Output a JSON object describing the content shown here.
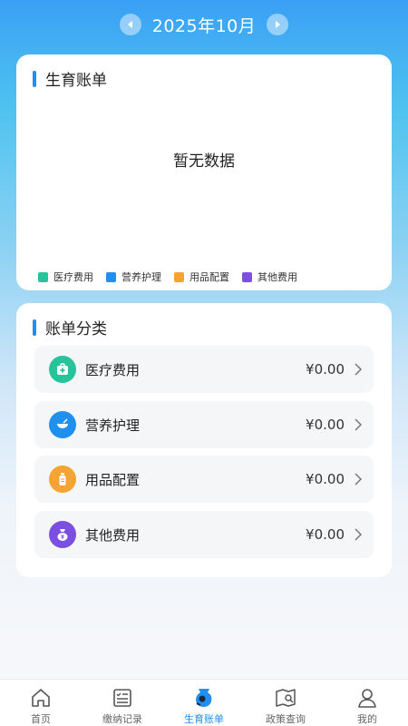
{
  "header": {
    "month": "2025年10月",
    "prev_icon": "caret-left-icon",
    "next_icon": "caret-right-icon"
  },
  "bill_card": {
    "title": "生育账单",
    "empty_text": "暂无数据",
    "legend": [
      {
        "label": "医疗费用",
        "color": "#27c39a"
      },
      {
        "label": "营养护理",
        "color": "#1f8ff0"
      },
      {
        "label": "用品配置",
        "color": "#f5a432"
      },
      {
        "label": "其他费用",
        "color": "#7b4fe0"
      }
    ]
  },
  "category_card": {
    "title": "账单分类",
    "items": [
      {
        "label": "医疗费用",
        "amount": "¥0.00",
        "color": "#27c39a",
        "icon": "medical-kit-icon"
      },
      {
        "label": "营养护理",
        "amount": "¥0.00",
        "color": "#1f8ff0",
        "icon": "bowl-icon"
      },
      {
        "label": "用品配置",
        "amount": "¥0.00",
        "color": "#f5a432",
        "icon": "bottle-icon"
      },
      {
        "label": "其他费用",
        "amount": "¥0.00",
        "color": "#7b4fe0",
        "icon": "money-bag-icon"
      }
    ]
  },
  "nav": {
    "active_color": "#1f8ff0",
    "items": [
      {
        "label": "首页",
        "icon": "home-icon"
      },
      {
        "label": "缴纳记录",
        "icon": "records-icon"
      },
      {
        "label": "生育账单",
        "icon": "baby-bill-icon",
        "active": true
      },
      {
        "label": "政策查询",
        "icon": "policy-search-icon"
      },
      {
        "label": "我的",
        "icon": "profile-icon"
      }
    ]
  }
}
